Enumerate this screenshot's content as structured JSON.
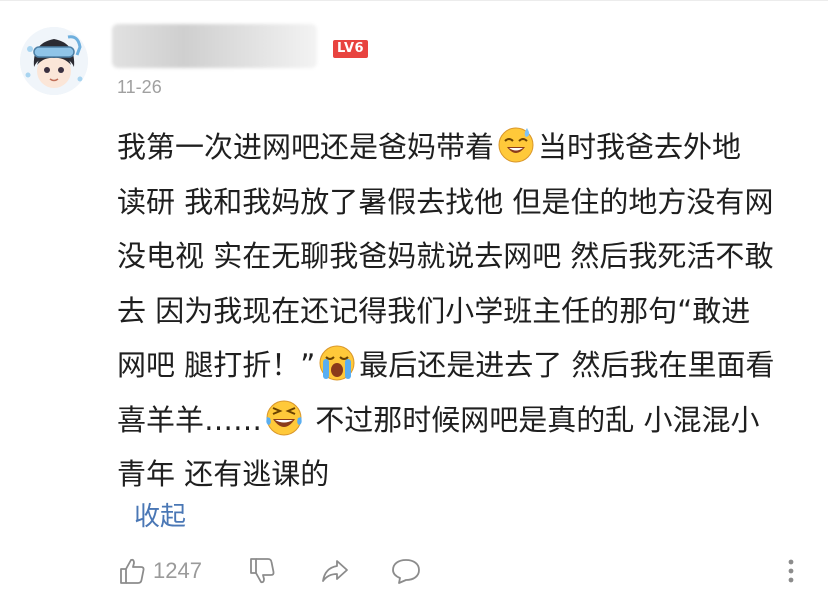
{
  "post": {
    "level_badge": "LV6",
    "date": "11-26"
  },
  "comment": {
    "line1a": "我第一次进网吧还是爸妈带着",
    "line1b": "当时我爸去外地",
    "line2": "读研 我和我妈放了暑假去找他 但是住的地方没有网",
    "line3": "没电视 实在无聊我爸妈就说去网吧 然后我死活不敢",
    "line4": "去 因为我现在还记得我们小学班主任的那句“敢进",
    "line5a": "网吧 腿打折！”",
    "line5b": "最后还是进去了 然后我在里面看",
    "line6a": "喜羊羊……",
    "line6b": " 不过那时候网吧是真的乱 小混混小",
    "line7": "青年 还有逃课的"
  },
  "actions": {
    "collapse_label": "收起",
    "like_count": "1247"
  },
  "icons": {
    "emoji1": "sweat-smile-emoji-icon",
    "emoji2": "crying-emoji-icon",
    "emoji3": "laughing-tears-emoji-icon",
    "like": "thumbs-up-icon",
    "dislike": "thumbs-down-icon",
    "share": "share-arrow-icon",
    "comment": "comment-bubble-icon",
    "more": "more-vertical-icon"
  },
  "colors": {
    "link": "#4a77b5",
    "badge": "#e8433f",
    "meta": "#a0a0a0"
  }
}
